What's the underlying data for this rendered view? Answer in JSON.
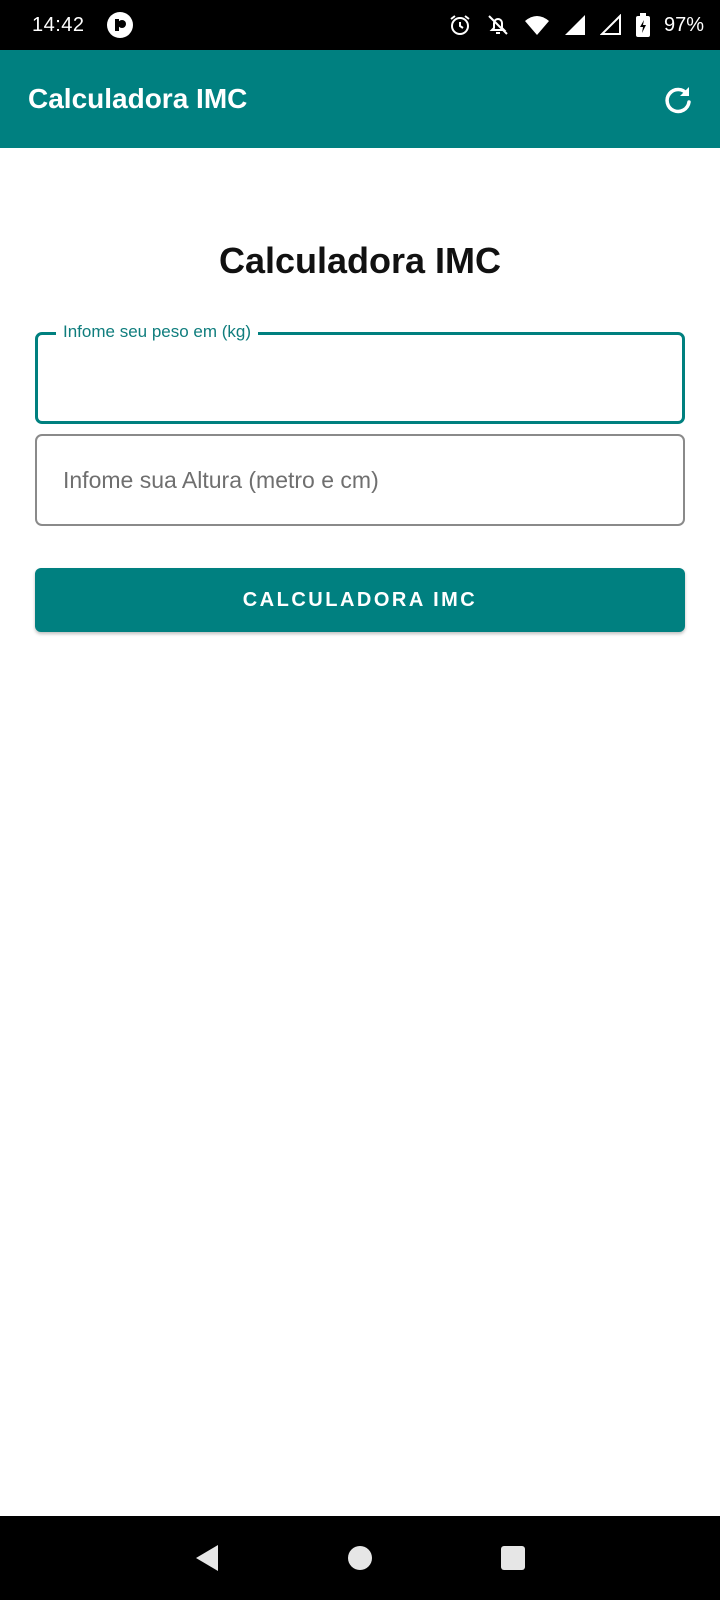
{
  "status_bar": {
    "time": "14:42",
    "battery": "97%",
    "icons": [
      "app-notification-icon",
      "alarm-icon",
      "notifications-off-icon",
      "wifi-icon",
      "signal-icon",
      "signal-empty-icon",
      "battery-icon"
    ]
  },
  "app_bar": {
    "title": "Calculadora IMC",
    "refresh_icon": "refresh-icon"
  },
  "main": {
    "heading": "Calculadora IMC",
    "weight_field": {
      "label": "Infome seu peso em (kg)",
      "value": ""
    },
    "height_field": {
      "placeholder": "Infome sua Altura (metro e cm)",
      "value": ""
    },
    "calculate_button": "CALCULADORA IMC"
  },
  "nav_bar": {
    "icons": [
      "back-icon",
      "home-icon",
      "recents-icon"
    ]
  },
  "colors": {
    "primary": "#008080",
    "status_bar": "#000000",
    "nav_bar": "#000000",
    "background": "#ffffff"
  }
}
